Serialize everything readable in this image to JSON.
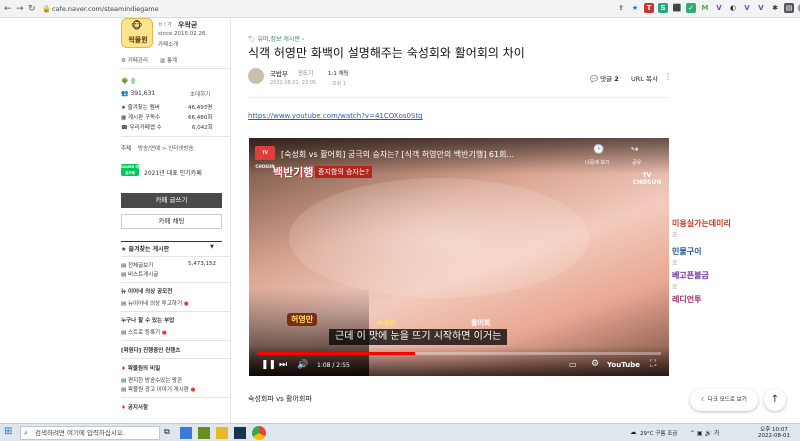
{
  "browser": {
    "url": "cafe.naver.com/steamindiegame"
  },
  "cafe": {
    "name_prefix": "ㅂㅣ가",
    "name": "우왁굳",
    "since": "since 2015.02.26.",
    "cafe_intro": "카페소개",
    "manage": "카페관리",
    "stats": "통계",
    "logo_text": "왁물원",
    "level_badge": "숲",
    "members": "391,631",
    "invite": "초대하기",
    "favorite_members_label": "즐겨찾는 멤버",
    "favorite_members_value": "46,493명",
    "subscribers_label": "게시판 구독수",
    "subscribers_value": "66,480회",
    "our_cafe_label": "우리카페앱 수",
    "our_cafe_value": "6,042회",
    "topic": "주제",
    "topic_value": "방송/연예 > 인터넷방송",
    "award_badge": "NAVER 대표카페",
    "award_text": "2021년 대표 인기카페",
    "write_button": "카페 글쓰기",
    "chat_button": "카페 채팅"
  },
  "menu": {
    "favorites_header": "즐겨찾는 게시판",
    "all_posts": "전체글보기",
    "all_posts_count": "5,473,152",
    "popular_posts": "비스트게시글",
    "section1": "뉴 이어네 의상 공모전",
    "item1": "뉴이어네 의상 투고하기",
    "section2": "누구나 할 수 있는 부업",
    "item2": "스트로 등록기",
    "section3": "[왁원다] 진행중인 컨텐츠",
    "section4": "왁물원의 비밀",
    "item4a": "편지한 방송수있는 왕관",
    "item4b": "왁물원 광고 이야기 게시판",
    "section5": "공지사항"
  },
  "article": {
    "category": "유머,정보 게시판",
    "title": "식객 허영만 화백이 설명해주는 숙성회와 활어회의 차이",
    "author": "국밥부",
    "author_tag": "진도기",
    "author_grade": "1:1 채팅",
    "date": "2022.08.01. 22:05",
    "views": "조회 1",
    "comments_label": "댓글",
    "comments_count": "2",
    "url_copy": "URL 복사",
    "link": "https://www.youtube.com/watch?v=41COXos0Stg",
    "caption": "숙성회파 vs 활어회파"
  },
  "video": {
    "channel_logo": "TV CHOSUN",
    "title": "[숙성회 vs 활어회] 궁극의 승자는? [식객 허영만의 백반기행] 61회...",
    "watch_later": "나중에 보기",
    "share": "공유",
    "brand": "TV CHOSUN",
    "show_title": "백반기행",
    "overlay_question": "중지함의 승자는?",
    "tag_left": "허영만",
    "tag_center": "숙성회",
    "tag_right": "활어회",
    "subtitle": "근데 이 맛에 눈을 뜨기 시작하면 이거는",
    "time": "1:08 / 2:55",
    "progress": 0.39,
    "youtube": "YouTube"
  },
  "right_panel": {
    "items": [
      {
        "label": "미용실가는데미리",
        "sub": "오"
      },
      {
        "label": "민물구이",
        "sub": "오"
      },
      {
        "label": "베고픈불금",
        "sub": "오"
      },
      {
        "label": "레디언투",
        "sub": ""
      }
    ],
    "dark_mode": "다크 모드로 보기"
  },
  "taskbar": {
    "search_placeholder": "검색하려면 여기에 입력하십시오.",
    "weather": "29°C 구름 조금",
    "time": "오후 10:07",
    "date": "2022-08-01"
  },
  "colors": {
    "naver_green": "#03c75a",
    "accent_red": "#e03d3d",
    "link_blue": "#2a5db0"
  }
}
